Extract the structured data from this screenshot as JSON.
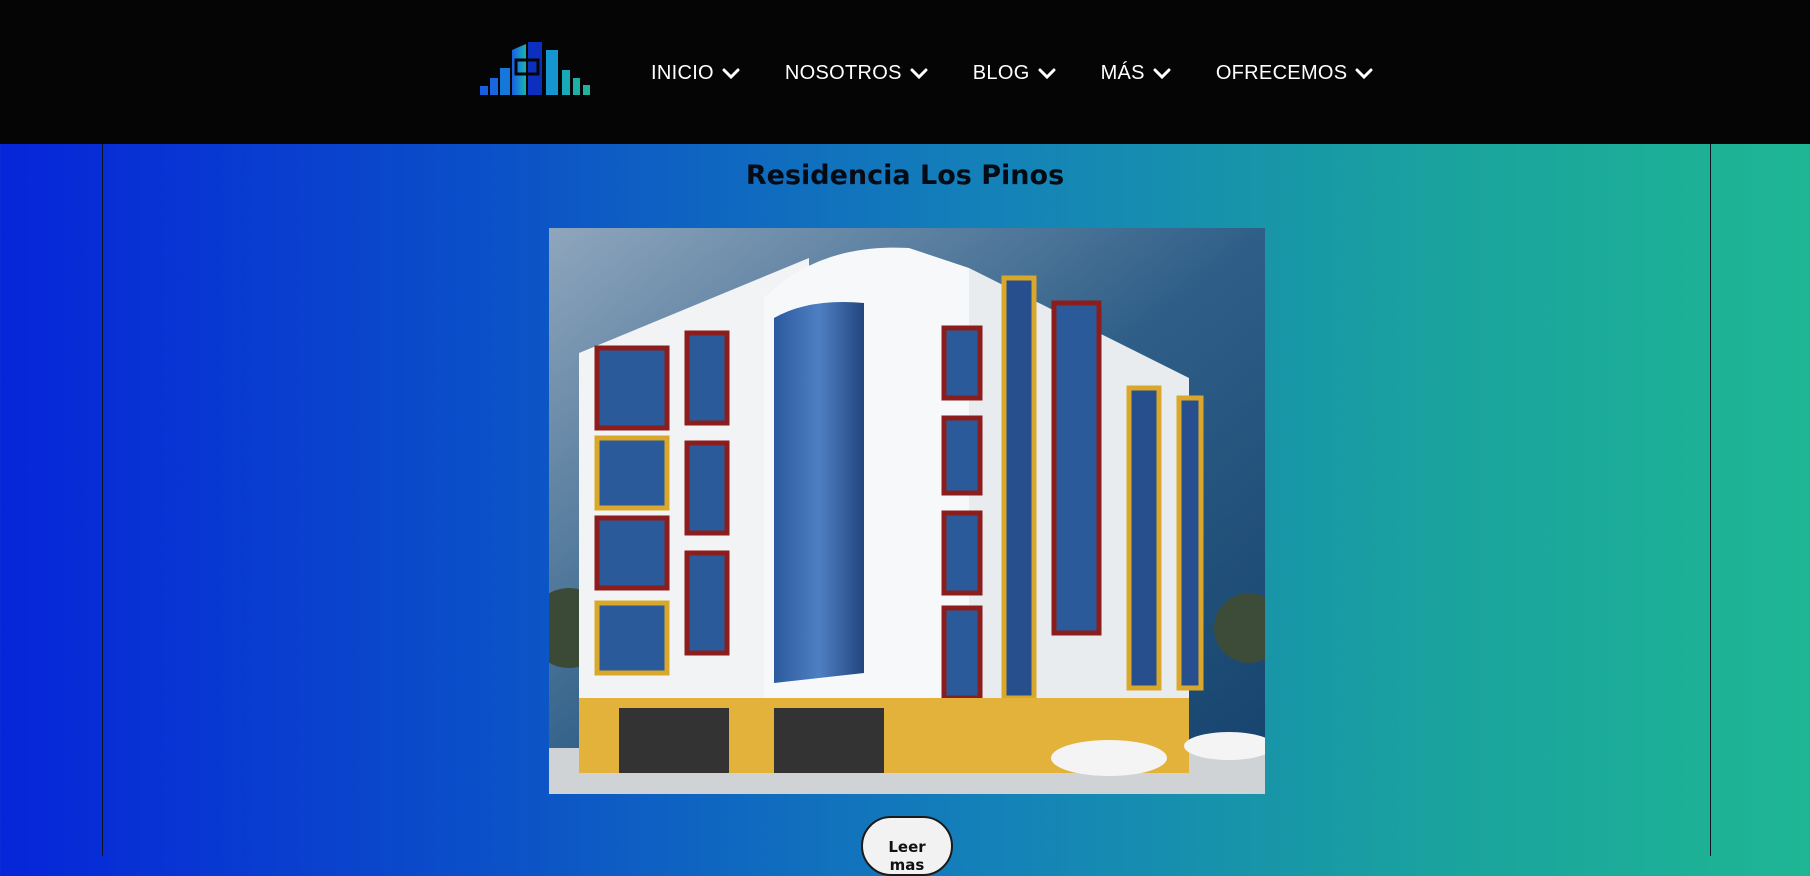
{
  "header": {
    "logo_icon": "building-logo-icon",
    "nav": [
      {
        "label": "INICIO",
        "icon": "chevron-down-icon"
      },
      {
        "label": "NOSOTROS",
        "icon": "chevron-down-icon"
      },
      {
        "label": "BLOG",
        "icon": "chevron-down-icon"
      },
      {
        "label": "MÁS",
        "icon": "chevron-down-icon"
      },
      {
        "label": "OFRECEMOS",
        "icon": "chevron-down-icon"
      }
    ]
  },
  "main": {
    "title": "Residencia Los Pinos",
    "image_subject": "building-rendering",
    "read_more_label": "Leer mas"
  },
  "colors": {
    "header_bg": "#050505",
    "gradient_start": "#0625d9",
    "gradient_end": "#1eb694",
    "logo_blue": "#1560d8",
    "logo_teal": "#1fb39a"
  }
}
